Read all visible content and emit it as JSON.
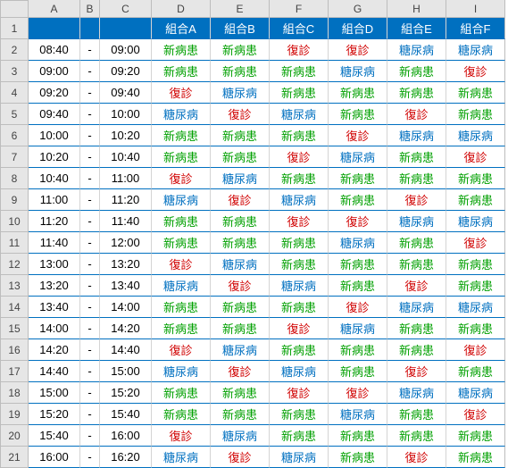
{
  "columns": [
    "",
    "A",
    "B",
    "C",
    "D",
    "E",
    "F",
    "G",
    "H",
    "I"
  ],
  "group_headers": [
    "組合A",
    "組合B",
    "組合C",
    "組合D",
    "組合E",
    "組合F"
  ],
  "value_colors": {
    "新病患": "c-green",
    "復診": "c-red",
    "糖尿病": "c-blue"
  },
  "rows": [
    {
      "n": 2,
      "start": "08:40",
      "end": "09:00",
      "v": [
        "新病患",
        "新病患",
        "復診",
        "復診",
        "糖尿病",
        "糖尿病"
      ]
    },
    {
      "n": 3,
      "start": "09:00",
      "end": "09:20",
      "v": [
        "新病患",
        "新病患",
        "新病患",
        "糖尿病",
        "新病患",
        "復診"
      ]
    },
    {
      "n": 4,
      "start": "09:20",
      "end": "09:40",
      "v": [
        "復診",
        "糖尿病",
        "新病患",
        "新病患",
        "新病患",
        "新病患"
      ]
    },
    {
      "n": 5,
      "start": "09:40",
      "end": "10:00",
      "v": [
        "糖尿病",
        "復診",
        "糖尿病",
        "新病患",
        "復診",
        "新病患"
      ]
    },
    {
      "n": 6,
      "start": "10:00",
      "end": "10:20",
      "v": [
        "新病患",
        "新病患",
        "新病患",
        "復診",
        "糖尿病",
        "糖尿病"
      ]
    },
    {
      "n": 7,
      "start": "10:20",
      "end": "10:40",
      "v": [
        "新病患",
        "新病患",
        "復診",
        "糖尿病",
        "新病患",
        "復診"
      ]
    },
    {
      "n": 8,
      "start": "10:40",
      "end": "11:00",
      "v": [
        "復診",
        "糖尿病",
        "新病患",
        "新病患",
        "新病患",
        "新病患"
      ]
    },
    {
      "n": 9,
      "start": "11:00",
      "end": "11:20",
      "v": [
        "糖尿病",
        "復診",
        "糖尿病",
        "新病患",
        "復診",
        "新病患"
      ]
    },
    {
      "n": 10,
      "start": "11:20",
      "end": "11:40",
      "v": [
        "新病患",
        "新病患",
        "復診",
        "復診",
        "糖尿病",
        "糖尿病"
      ]
    },
    {
      "n": 11,
      "start": "11:40",
      "end": "12:00",
      "v": [
        "新病患",
        "新病患",
        "新病患",
        "糖尿病",
        "新病患",
        "復診"
      ]
    },
    {
      "n": 12,
      "start": "13:00",
      "end": "13:20",
      "v": [
        "復診",
        "糖尿病",
        "新病患",
        "新病患",
        "新病患",
        "新病患"
      ]
    },
    {
      "n": 13,
      "start": "13:20",
      "end": "13:40",
      "v": [
        "糖尿病",
        "復診",
        "糖尿病",
        "新病患",
        "復診",
        "新病患"
      ]
    },
    {
      "n": 14,
      "start": "13:40",
      "end": "14:00",
      "v": [
        "新病患",
        "新病患",
        "新病患",
        "復診",
        "糖尿病",
        "糖尿病"
      ]
    },
    {
      "n": 15,
      "start": "14:00",
      "end": "14:20",
      "v": [
        "新病患",
        "新病患",
        "復診",
        "糖尿病",
        "新病患",
        "新病患"
      ]
    },
    {
      "n": 16,
      "start": "14:20",
      "end": "14:40",
      "v": [
        "復診",
        "糖尿病",
        "新病患",
        "新病患",
        "新病患",
        "復診"
      ]
    },
    {
      "n": 17,
      "start": "14:40",
      "end": "15:00",
      "v": [
        "糖尿病",
        "復診",
        "糖尿病",
        "新病患",
        "復診",
        "新病患"
      ]
    },
    {
      "n": 18,
      "start": "15:00",
      "end": "15:20",
      "v": [
        "新病患",
        "新病患",
        "復診",
        "復診",
        "糖尿病",
        "糖尿病"
      ]
    },
    {
      "n": 19,
      "start": "15:20",
      "end": "15:40",
      "v": [
        "新病患",
        "新病患",
        "新病患",
        "糖尿病",
        "新病患",
        "復診"
      ]
    },
    {
      "n": 20,
      "start": "15:40",
      "end": "16:00",
      "v": [
        "復診",
        "糖尿病",
        "新病患",
        "新病患",
        "新病患",
        "新病患"
      ]
    },
    {
      "n": 21,
      "start": "16:00",
      "end": "16:20",
      "v": [
        "糖尿病",
        "復診",
        "糖尿病",
        "新病患",
        "復診",
        "新病患"
      ]
    }
  ],
  "dash": "-"
}
